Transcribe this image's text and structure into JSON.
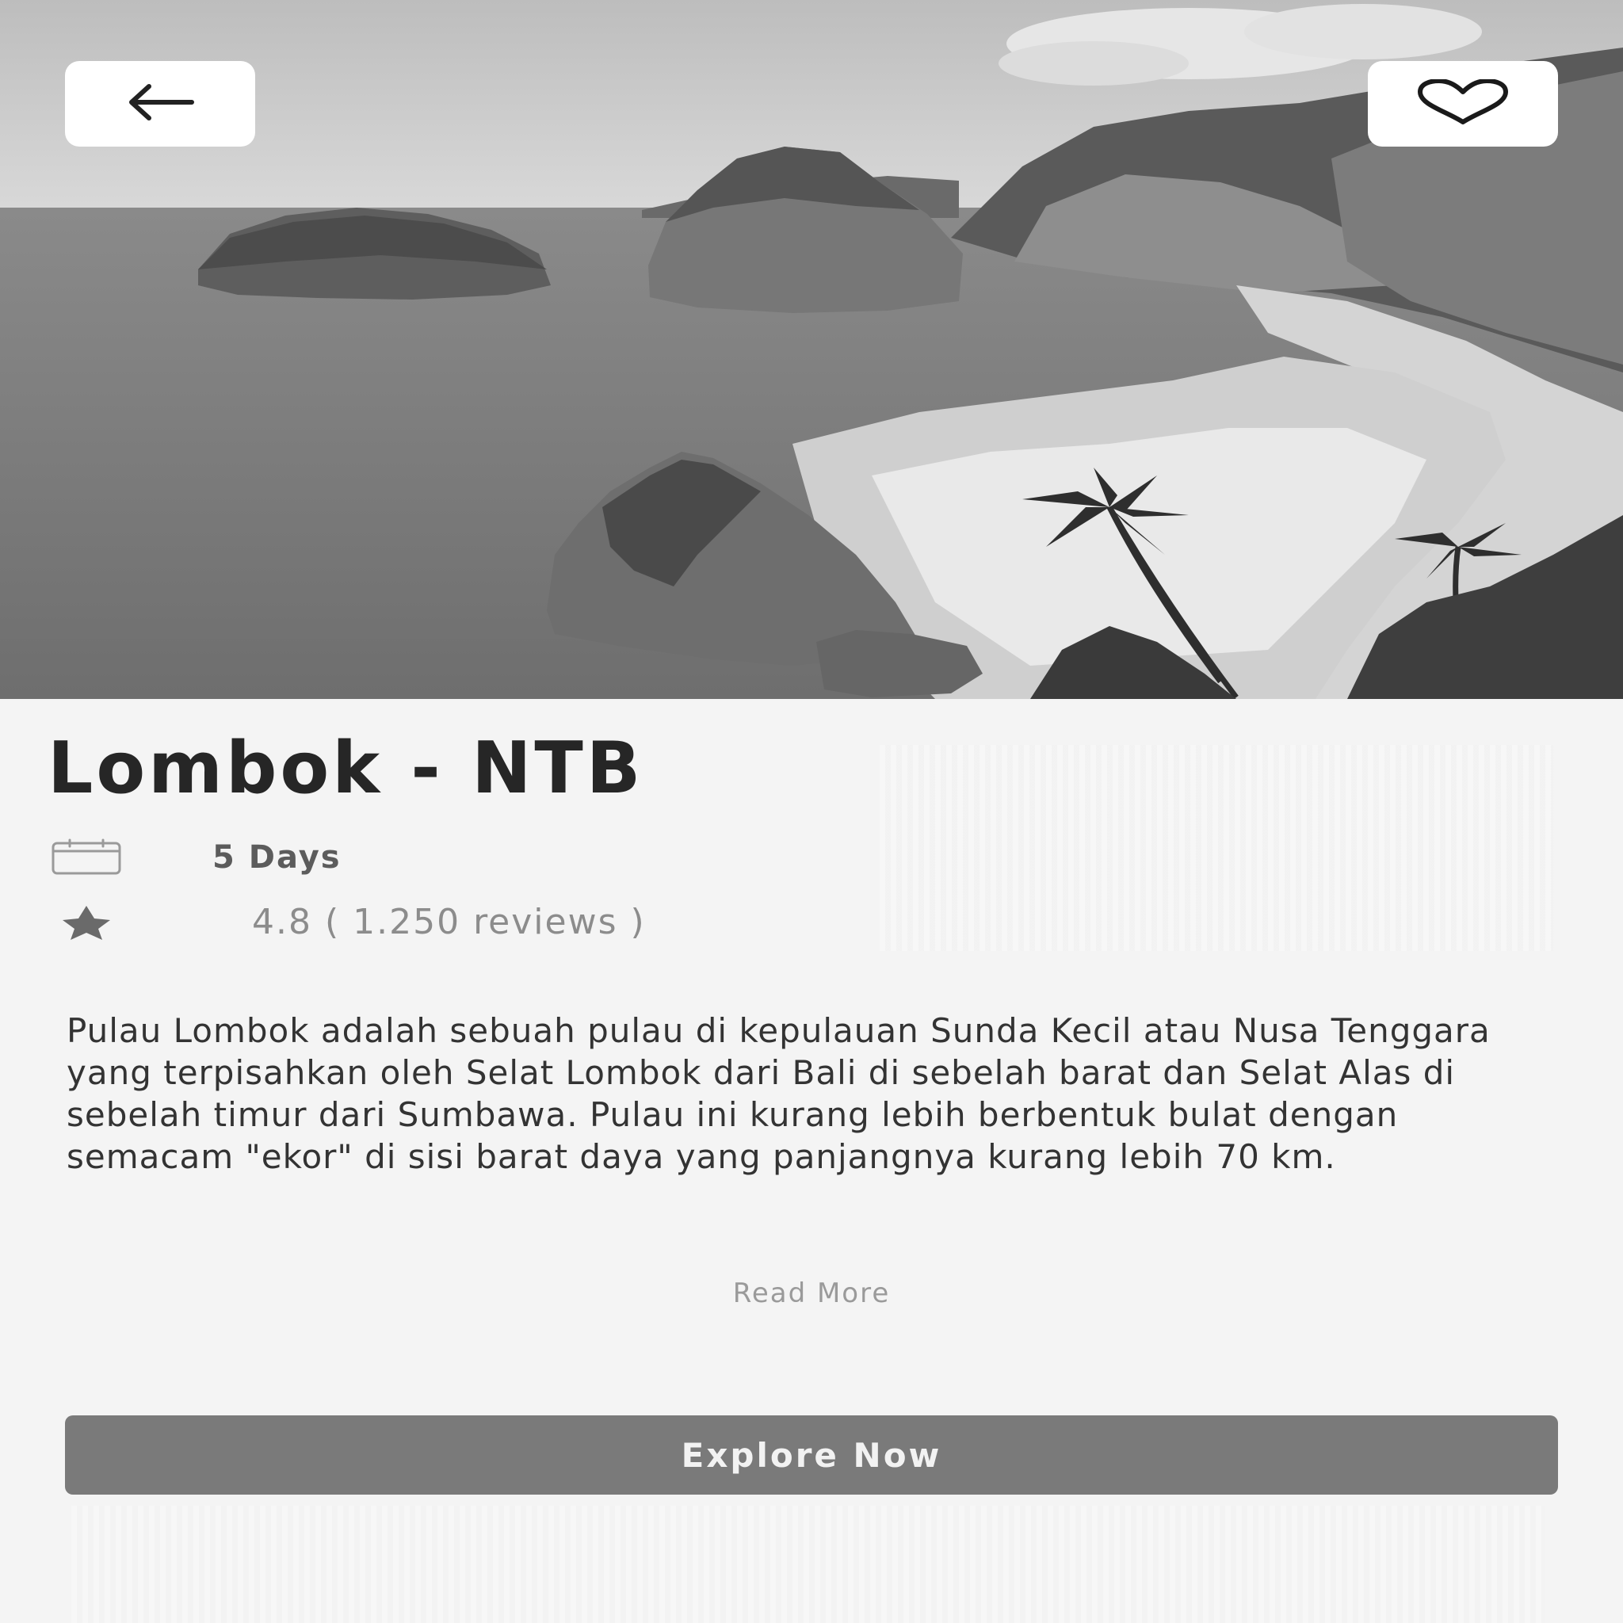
{
  "header": {
    "back_icon": "arrow-left-icon",
    "favorite_icon": "heart-icon"
  },
  "hero": {
    "image": "coastal landscape photo with sea stacks, beach and palm trees"
  },
  "destination": {
    "title": "Lombok - NTB",
    "duration": "5 Days",
    "duration_icon": "calendar-icon",
    "rating_icon": "star-icon",
    "rating_text": "4.8 ( 1.250 reviews )",
    "description": "Pulau Lombok adalah sebuah pulau di kepulauan Sunda Kecil atau Nusa Tenggara yang terpisahkan oleh Selat Lombok dari Bali di sebelah barat dan Selat Alas di sebelah timur dari Sumbawa. Pulau ini kurang lebih berbentuk bulat dengan semacam \"ekor\" di sisi barat daya yang panjangnya kurang lebih 70 km.",
    "read_more_label": "Read More"
  },
  "actions": {
    "explore_label": "Explore Now"
  }
}
